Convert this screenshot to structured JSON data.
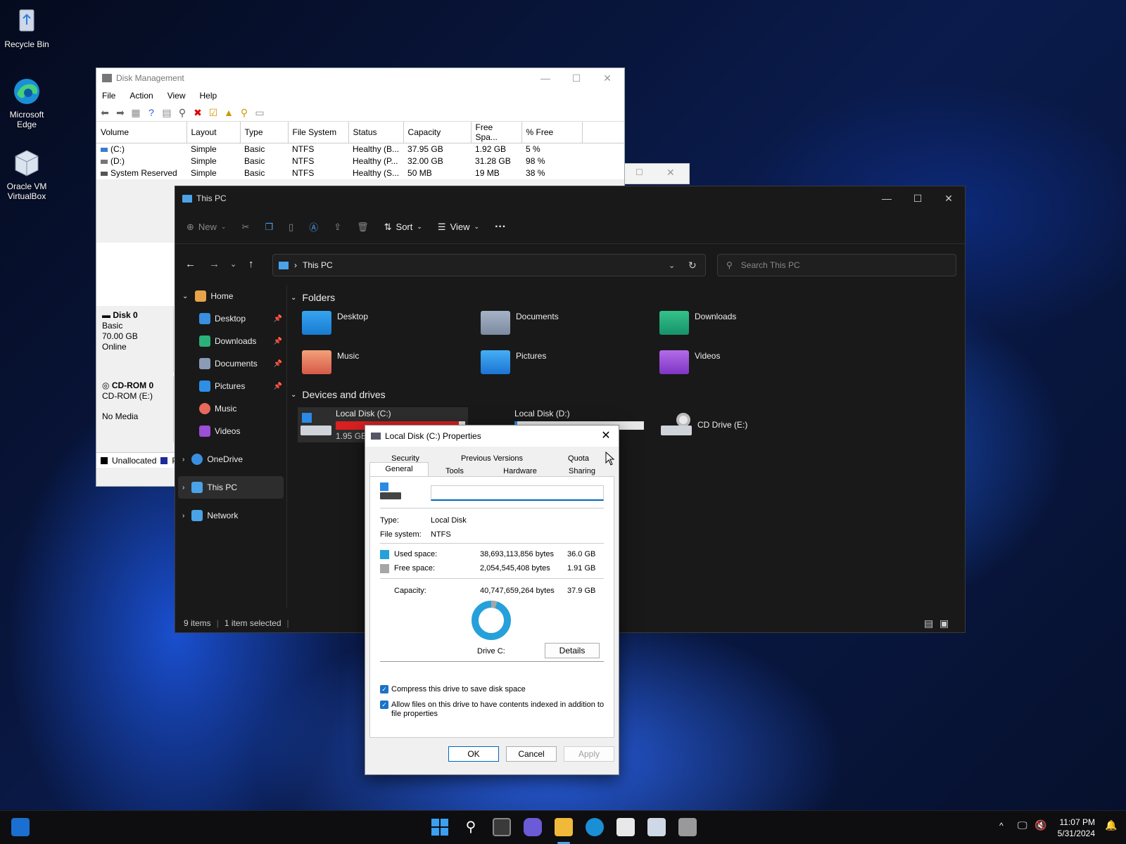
{
  "desktop": {
    "icons": [
      {
        "label": "Recycle Bin"
      },
      {
        "label": "Microsoft Edge"
      },
      {
        "label": "Oracle VM VirtualBox"
      }
    ]
  },
  "disk_management": {
    "title": "Disk Management",
    "menu": [
      "File",
      "Action",
      "View",
      "Help"
    ],
    "columns": [
      "Volume",
      "Layout",
      "Type",
      "File System",
      "Status",
      "Capacity",
      "Free Spa...",
      "% Free"
    ],
    "rows": [
      [
        "(C:)",
        "Simple",
        "Basic",
        "NTFS",
        "Healthy (B...",
        "37.95 GB",
        "1.92 GB",
        "5 %"
      ],
      [
        "(D:)",
        "Simple",
        "Basic",
        "NTFS",
        "Healthy (P...",
        "32.00 GB",
        "31.28 GB",
        "98 %"
      ],
      [
        "System Reserved",
        "Simple",
        "Basic",
        "NTFS",
        "Healthy (S...",
        "50 MB",
        "19 MB",
        "38 %"
      ]
    ],
    "disk0": {
      "name": "Disk 0",
      "type": "Basic",
      "size": "70.00 GB",
      "state": "Online"
    },
    "cdrom0": {
      "name": "CD-ROM 0",
      "type": "CD-ROM (E:)",
      "state": "No Media"
    },
    "legend": [
      "Unallocated",
      "P"
    ]
  },
  "explorer": {
    "title": "This PC",
    "cmd": {
      "new": "New",
      "sort": "Sort",
      "view": "View",
      "more": "···"
    },
    "address": "This PC",
    "search_placeholder": "Search This PC",
    "nav": {
      "home": "Home",
      "desktop": "Desktop",
      "downloads": "Downloads",
      "documents": "Documents",
      "pictures": "Pictures",
      "music": "Music",
      "videos": "Videos",
      "onedrive": "OneDrive",
      "thispc": "This PC",
      "network": "Network"
    },
    "folders_heading": "Folders",
    "folders": [
      "Desktop",
      "Documents",
      "Downloads",
      "Music",
      "Pictures",
      "Videos"
    ],
    "drives_heading": "Devices and drives",
    "drives": {
      "c": {
        "name": "Local Disk (C:)",
        "free": "1.95 GB",
        "used_fraction": 0.95
      },
      "d": {
        "name": "Local Disk (D:)",
        "used_fraction": 0.02
      },
      "e": {
        "name": "CD Drive (E:)"
      }
    },
    "status": {
      "items": "9 items",
      "selected": "1 item selected"
    }
  },
  "properties": {
    "title": "Local Disk (C:) Properties",
    "tabs_row1": [
      "Security",
      "Previous Versions",
      "Quota"
    ],
    "tabs_row2": [
      "General",
      "Tools",
      "Hardware",
      "Sharing"
    ],
    "name_value": "",
    "type_label": "Type:",
    "type_value": "Local Disk",
    "fs_label": "File system:",
    "fs_value": "NTFS",
    "used_label": "Used space:",
    "used_bytes": "38,693,113,856 bytes",
    "used_gb": "36.0 GB",
    "free_label": "Free space:",
    "free_bytes": "2,054,545,408 bytes",
    "free_gb": "1.91 GB",
    "cap_label": "Capacity:",
    "cap_bytes": "40,747,659,264 bytes",
    "cap_gb": "37.9 GB",
    "drive_label": "Drive C:",
    "details": "Details",
    "compress": "Compress this drive to save disk space",
    "index_line1": "Allow files on this drive to have contents indexed in addition to",
    "index_line2": "file properties",
    "ok": "OK",
    "cancel": "Cancel",
    "apply": "Apply",
    "used_color": "#26a0da",
    "free_color": "#a6a6a6"
  },
  "taskbar": {
    "time": "11:07 PM",
    "date": "5/31/2024"
  }
}
